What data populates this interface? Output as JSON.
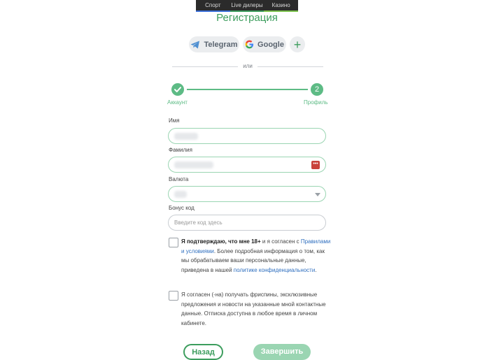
{
  "topnav": {
    "tabs": [
      "Спорт",
      "Live дилеры",
      "Казино"
    ]
  },
  "title": "Регистрация",
  "social": {
    "telegram": "Telegram",
    "google": "Google",
    "more": "+"
  },
  "divider_text": "или",
  "steps": {
    "step1_label": "Аккаунт",
    "step2_number": "2",
    "step2_label": "Профиль"
  },
  "form": {
    "first_name_label": "Имя",
    "last_name_label": "Фамилия",
    "currency_label": "Валюта",
    "bonus_label": "Бонус код",
    "bonus_placeholder": "Введите код здесь"
  },
  "consent1": {
    "bold": "Я подтверждаю, что мне 18+",
    "text1": " и я согласен с ",
    "link1": "Правилами и условиями",
    "text2": ". Более подробная информация о том, как мы обрабатываем ваши персональные данные, приведена в нашей ",
    "link2": "политике конфиденциальности",
    "text3": "."
  },
  "consent2": {
    "text": "Я согласен (-на) получать фриспины, эксклюзивные предложения и новости на указанные мной контактные данные. Отписка доступна в любое время в личном кабинете."
  },
  "buttons": {
    "back": "Назад",
    "finish": "Завершить"
  },
  "colors": {
    "accent": "#3c9d5d",
    "accent_light": "#9ad5b2",
    "link": "#2f6fbf"
  }
}
